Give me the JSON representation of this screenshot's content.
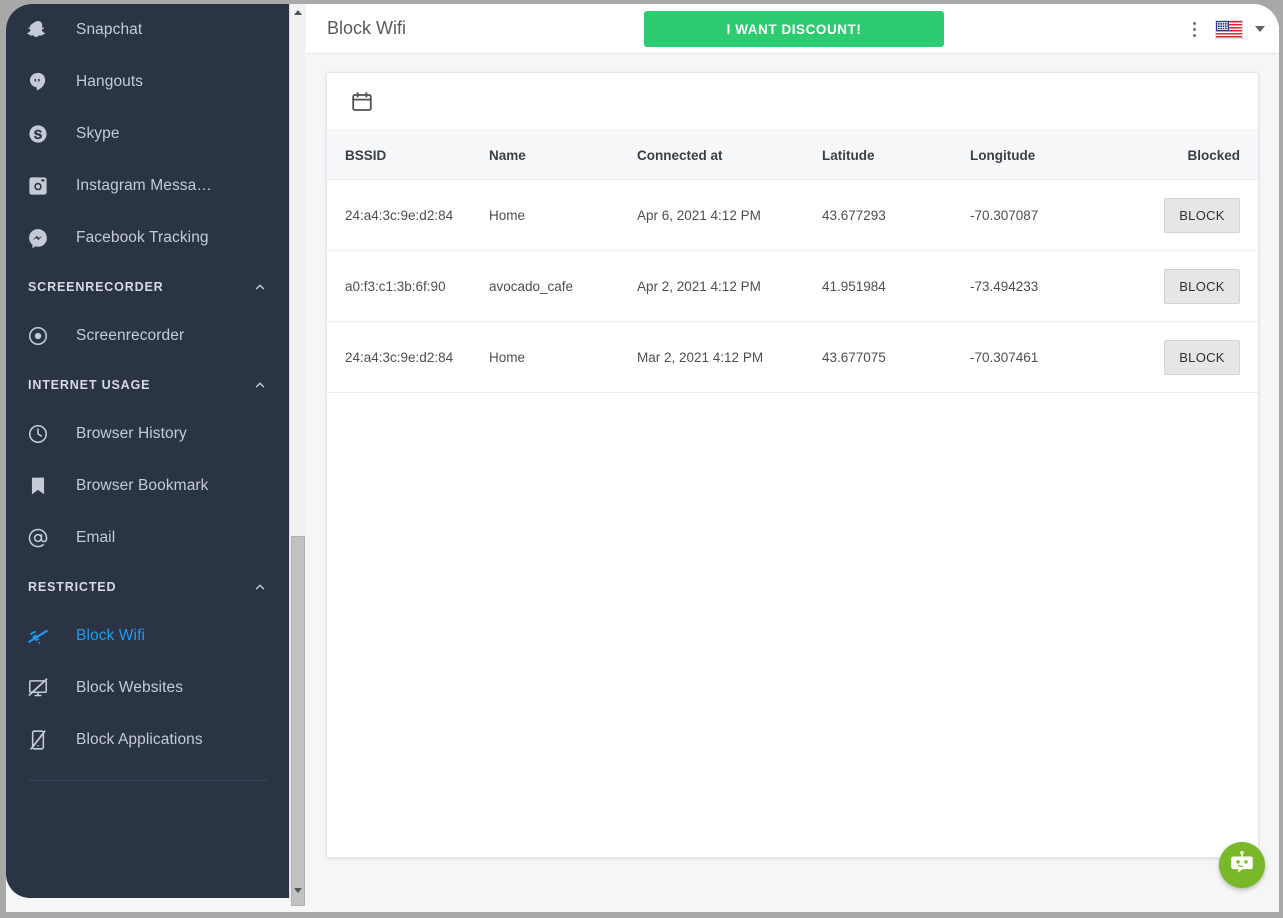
{
  "sidebar": {
    "items": [
      {
        "label": "Snapchat",
        "icon": "snapchat-icon",
        "type": "item",
        "active": false
      },
      {
        "label": "Hangouts",
        "icon": "hangouts-icon",
        "type": "item",
        "active": false
      },
      {
        "label": "Skype",
        "icon": "skype-icon",
        "type": "item",
        "active": false
      },
      {
        "label": "Instagram Messa…",
        "icon": "instagram-icon",
        "type": "item",
        "active": false
      },
      {
        "label": "Facebook Tracking",
        "icon": "facebook-messenger-icon",
        "type": "item",
        "active": false
      },
      {
        "label": "SCREENRECORDER",
        "icon": "chevron-up-icon",
        "type": "section"
      },
      {
        "label": "Screenrecorder",
        "icon": "record-icon",
        "type": "item",
        "active": false
      },
      {
        "label": "INTERNET USAGE",
        "icon": "chevron-up-icon",
        "type": "section"
      },
      {
        "label": "Browser History",
        "icon": "clock-icon",
        "type": "item",
        "active": false
      },
      {
        "label": "Browser Bookmark",
        "icon": "bookmark-icon",
        "type": "item",
        "active": false
      },
      {
        "label": "Email",
        "icon": "at-sign-icon",
        "type": "item",
        "active": false
      },
      {
        "label": "RESTRICTED",
        "icon": "chevron-up-icon",
        "type": "section"
      },
      {
        "label": "Block Wifi",
        "icon": "wifi-off-icon",
        "type": "item",
        "active": true
      },
      {
        "label": "Block Websites",
        "icon": "monitor-off-icon",
        "type": "item",
        "active": false
      },
      {
        "label": "Block Applications",
        "icon": "smartphone-off-icon",
        "type": "item",
        "active": false
      }
    ],
    "active_color": "#1f9cf0",
    "background": "#2b3444"
  },
  "topbar": {
    "title": "Block Wifi",
    "discount_label": "I WANT DISCOUNT!",
    "discount_color": "#2ecc71",
    "menu_icon": "kebab-menu-icon",
    "language_flag": "us-flag-icon",
    "language_caret": "chevron-down-icon"
  },
  "toolbar": {
    "calendar_icon": "calendar-icon"
  },
  "table": {
    "columns": [
      "BSSID",
      "Name",
      "Connected at",
      "Latitude",
      "Longitude",
      "Blocked"
    ],
    "rows": [
      {
        "bssid": "24:a4:3c:9e:d2:84",
        "name": "Home",
        "connected_at": "Apr 6, 2021 4:12 PM",
        "latitude": "43.677293",
        "longitude": "-70.307087",
        "action": "BLOCK"
      },
      {
        "bssid": "a0:f3:c1:3b:6f:90",
        "name": "avocado_cafe",
        "connected_at": "Apr 2, 2021 4:12 PM",
        "latitude": "41.951984",
        "longitude": "-73.494233",
        "action": "BLOCK"
      },
      {
        "bssid": "24:a4:3c:9e:d2:84",
        "name": "Home",
        "connected_at": "Mar 2, 2021 4:12 PM",
        "latitude": "43.677075",
        "longitude": "-70.307461",
        "action": "BLOCK"
      }
    ]
  },
  "chat": {
    "icon": "chat-robot-icon",
    "color": "#78b829"
  }
}
